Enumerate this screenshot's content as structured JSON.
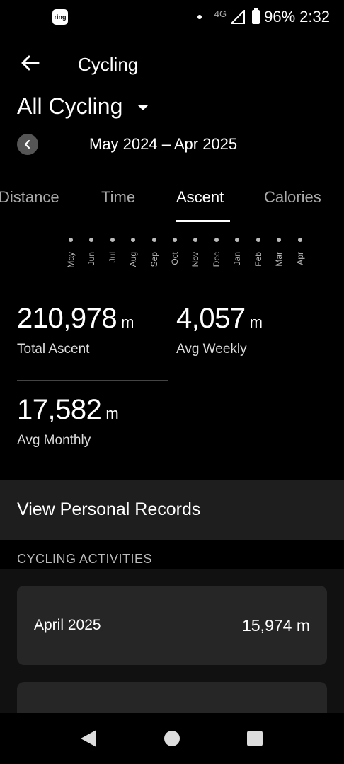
{
  "status_bar": {
    "app_icon_label": "ring",
    "network": "4G",
    "battery": "96%",
    "time": "2:32"
  },
  "header": {
    "title": "Cycling",
    "filter": "All Cycling",
    "date_range": "May 2024 – Apr 2025"
  },
  "tabs": [
    {
      "label": "Distance",
      "active": false
    },
    {
      "label": "Time",
      "active": false
    },
    {
      "label": "Ascent",
      "active": true
    },
    {
      "label": "Calories",
      "active": false
    }
  ],
  "months": [
    "May",
    "Jun",
    "Jul",
    "Aug",
    "Sep",
    "Oct",
    "Nov",
    "Dec",
    "Jan",
    "Feb",
    "Mar",
    "Apr"
  ],
  "stats": {
    "total_ascent": {
      "value": "210,978",
      "unit": "m",
      "label": "Total Ascent"
    },
    "avg_weekly": {
      "value": "4,057",
      "unit": "m",
      "label": "Avg Weekly"
    },
    "avg_monthly": {
      "value": "17,582",
      "unit": "m",
      "label": "Avg Monthly"
    }
  },
  "records": {
    "label": "View Personal Records"
  },
  "activities": {
    "heading": "CYCLING ACTIVITIES",
    "items": [
      {
        "name": "April 2025",
        "value": "15,974 m"
      },
      {
        "name": "",
        "value": ""
      }
    ]
  },
  "icons": {
    "back": "arrow-left-icon",
    "filter_caret": "caret-down-icon",
    "prev": "chevron-left-icon",
    "nav_back": "triangle-back-icon",
    "nav_home": "circle-home-icon",
    "nav_recent": "square-recent-icon"
  }
}
